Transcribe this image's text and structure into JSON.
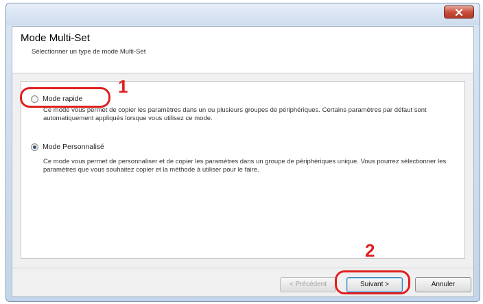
{
  "window": {
    "title": ""
  },
  "header": {
    "title": "Mode Multi-Set",
    "subtitle": "Sélectionner un type de mode Multi-Set"
  },
  "options": [
    {
      "label": "Mode rapide",
      "selected": false,
      "description": "Ce mode vous permet de copier les paramètres dans un ou plusieurs groupes de périphériques. Certains paramètres par défaut sont automatiquement appliqués lorsque vous utilisez ce mode."
    },
    {
      "label": "Mode Personnalisé",
      "selected": true,
      "description": "Ce mode vous permet de personnaliser et de copier les paramètres dans un groupe de périphériques unique. Vous pourrez sélectionner les paramètres que vous souhaitez copier et la méthode à utiliser pour le faire."
    }
  ],
  "buttons": {
    "previous": "< Précédent",
    "next": "Suivant >",
    "cancel": "Annuler"
  },
  "annotations": {
    "step1": "1",
    "step2": "2",
    "color": "#e02020"
  },
  "colors": {
    "close_button": "#c9503d",
    "window_frame": "#c3d5ea"
  }
}
